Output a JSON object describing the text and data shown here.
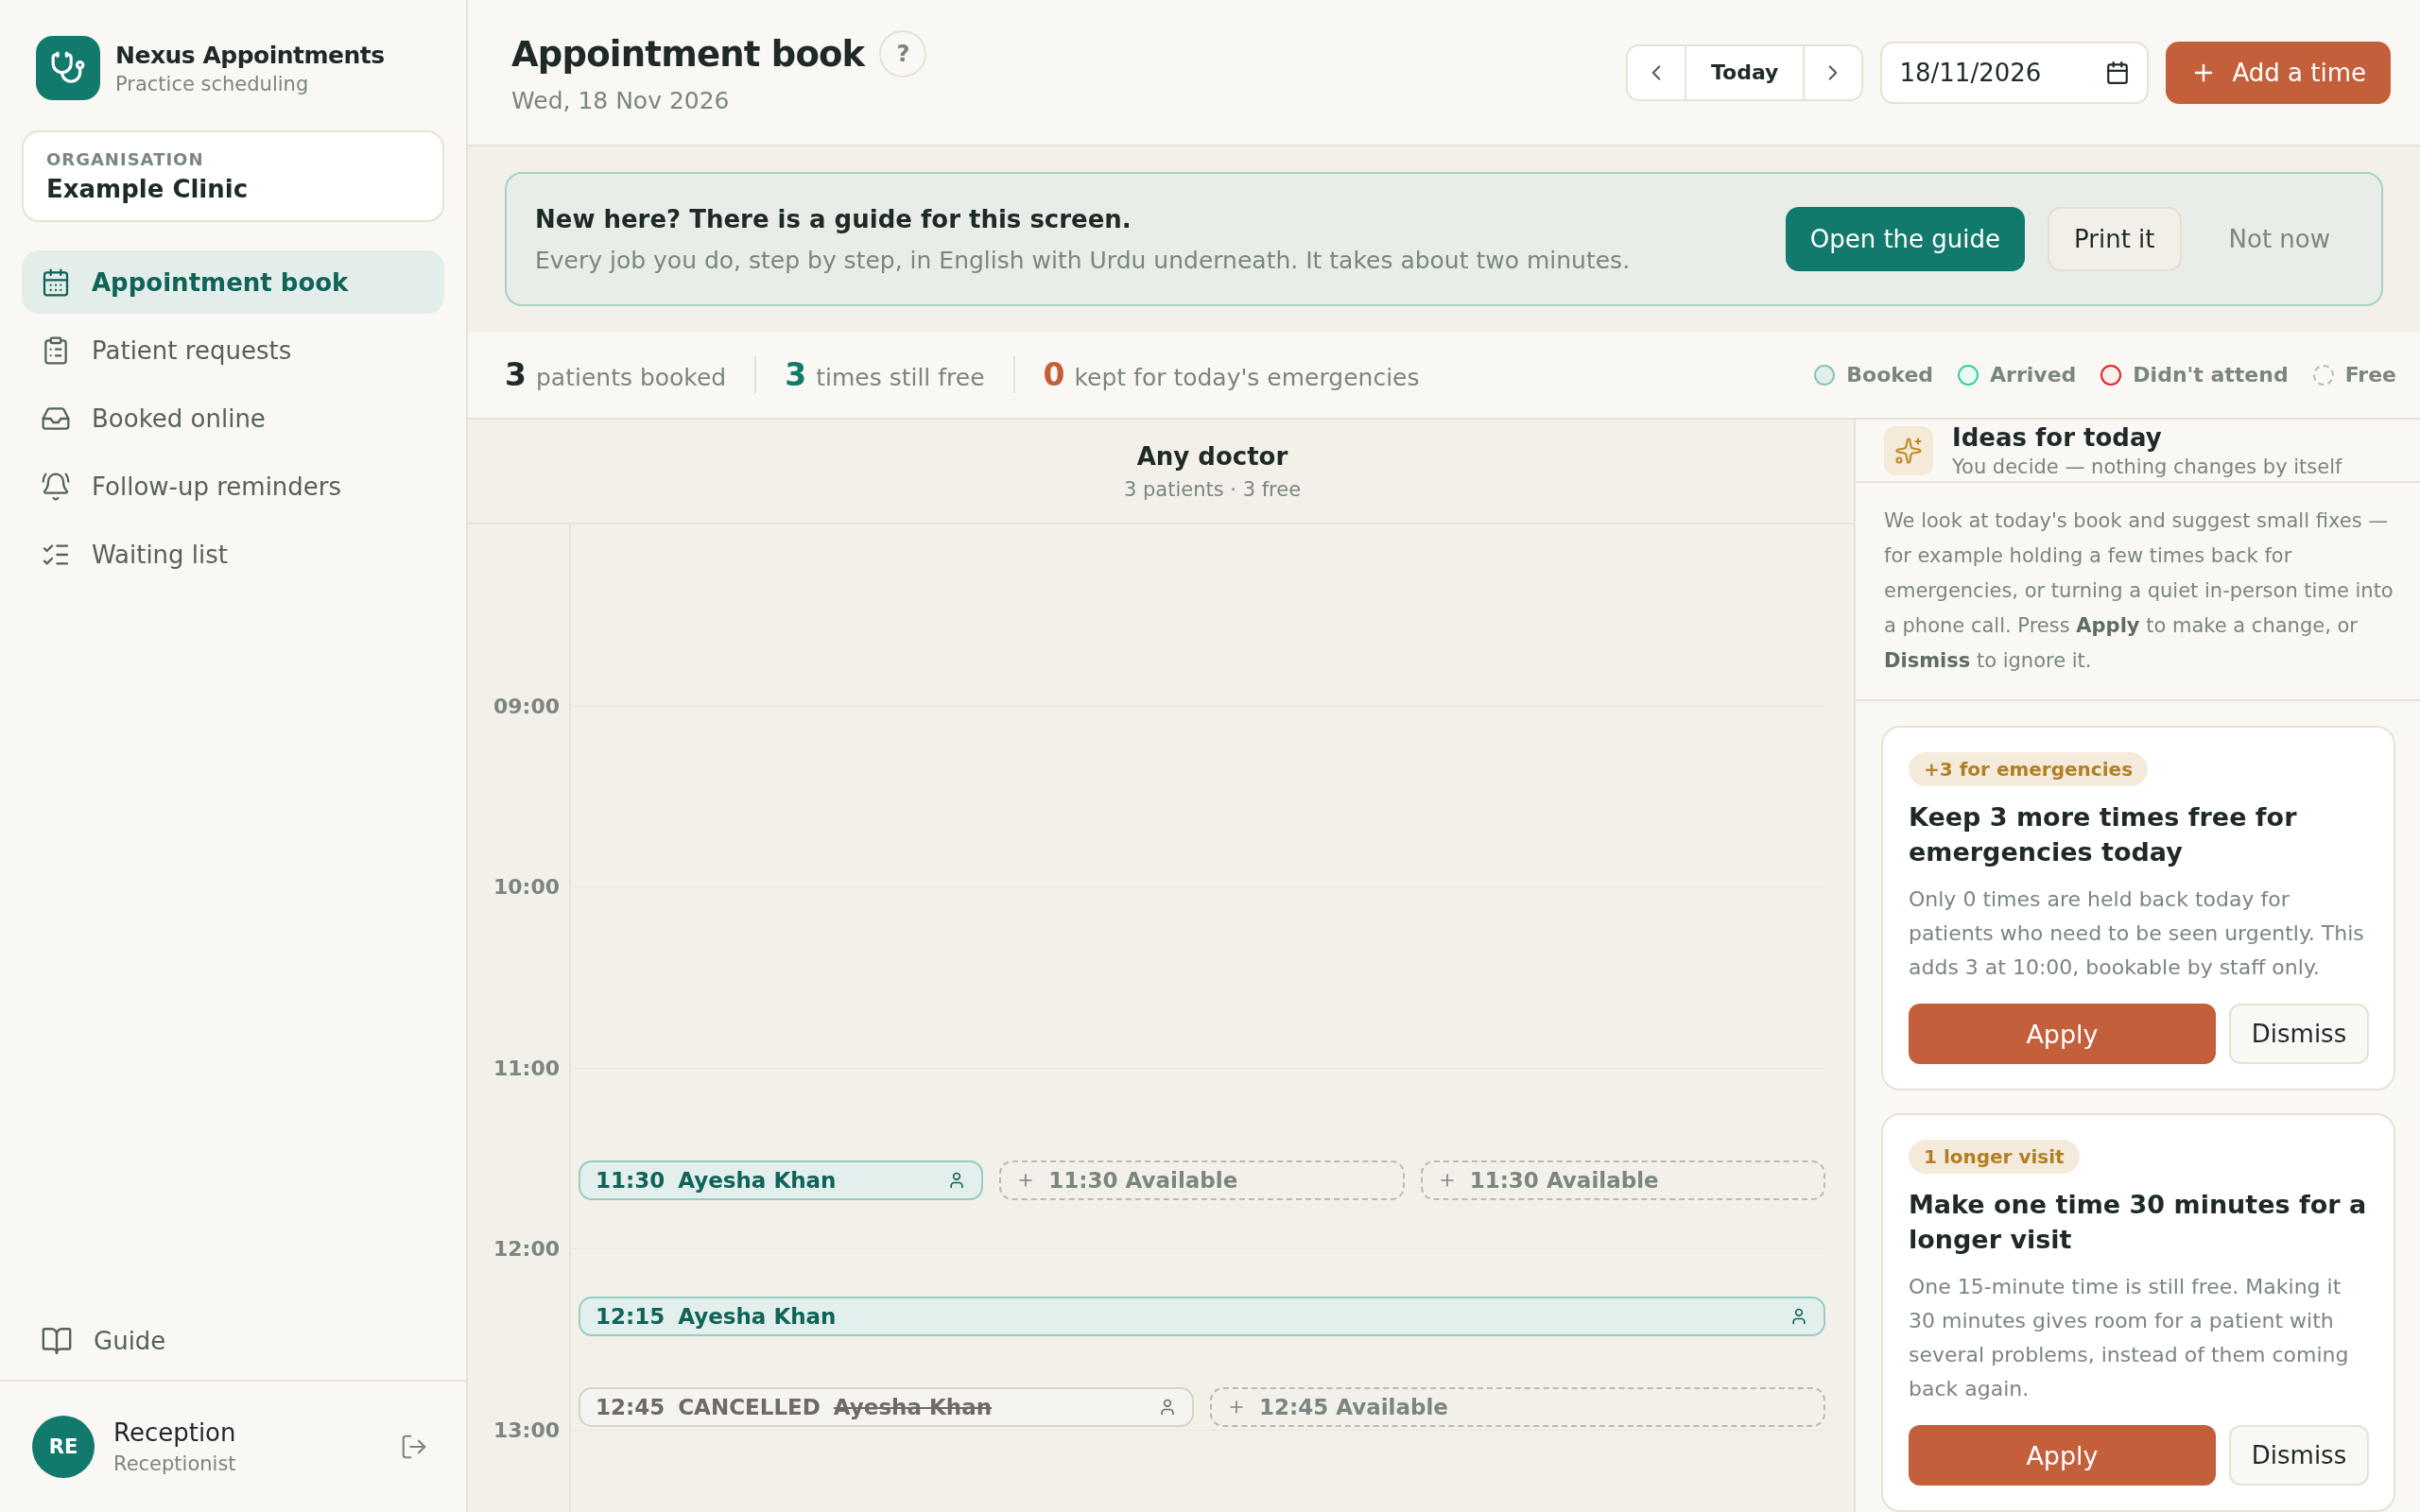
{
  "app": {
    "name": "Nexus Appointments",
    "subtitle": "Practice scheduling"
  },
  "organisation": {
    "label": "ORGANISATION",
    "name": "Example Clinic"
  },
  "nav": [
    {
      "label": "Appointment book",
      "selected": true
    },
    {
      "label": "Patient requests",
      "selected": false
    },
    {
      "label": "Booked online",
      "selected": false
    },
    {
      "label": "Follow-up reminders",
      "selected": false
    },
    {
      "label": "Waiting list",
      "selected": false
    }
  ],
  "guide_link": {
    "label": "Guide"
  },
  "user": {
    "initials": "RE",
    "name": "Reception",
    "role": "Receptionist"
  },
  "header": {
    "title": "Appointment book",
    "help": "?",
    "date": "Wed, 18 Nov 2026",
    "today": "Today",
    "date_field": "18/11/2026",
    "add": "Add a time"
  },
  "banner": {
    "title": "New here? There is a guide for this screen.",
    "text": "Every job you do, step by step, in English with Urdu underneath. It takes about two minutes.",
    "buttons": [
      {
        "label": "Open the guide",
        "kind": "primary"
      },
      {
        "label": "Print it",
        "kind": "secondary"
      },
      {
        "label": "Not now",
        "kind": "ghost"
      }
    ]
  },
  "stats": [
    {
      "value": "3",
      "label": "patients booked",
      "color": "#1f2a27"
    },
    {
      "value": "3",
      "label": "times still free",
      "color": "#127a6c"
    },
    {
      "value": "0",
      "label": "kept for today's emergencies",
      "color": "#c45f3c"
    }
  ],
  "legend": [
    {
      "label": "Booked",
      "kind": "booked"
    },
    {
      "label": "Arrived",
      "kind": "arrived"
    },
    {
      "label": "Didn't attend",
      "kind": "missed"
    },
    {
      "label": "Free",
      "kind": "free"
    }
  ],
  "calendar": {
    "column_title": "Any doctor",
    "column_subtitle": "3 patients · 3 free",
    "hours": [
      "09:00",
      "10:00",
      "11:00",
      "12:00",
      "13:00"
    ],
    "rows": [
      {
        "slots": [
          {
            "kind": "booked",
            "time": "11:30",
            "name": "Ayesha Khan"
          },
          {
            "kind": "free",
            "time": "11:30",
            "label": "Available"
          },
          {
            "kind": "free",
            "time": "11:30",
            "label": "Available"
          }
        ]
      },
      {
        "slots": [
          {
            "kind": "booked",
            "time": "12:15",
            "name": "Ayesha Khan"
          }
        ]
      },
      {
        "slots": [
          {
            "kind": "cancelled",
            "time": "12:45",
            "status": "CANCELLED",
            "name": "Ayesha Khan"
          },
          {
            "kind": "free",
            "time": "12:45",
            "label": "Available"
          }
        ]
      }
    ]
  },
  "ideas": {
    "title": "Ideas for today",
    "subtitle": "You decide — nothing changes by itself",
    "intro": "We look at today's book and suggest small fixes — for example holding a few times back for emergencies, or turning a quiet in-person time into a phone call. Press **Apply** to make a change, or **Dismiss** to ignore it.",
    "cards": [
      {
        "tag": "+3 for emergencies",
        "title": "Keep 3 more times free for emergencies today",
        "text": "Only 0 times are held back today for patients who need to be seen urgently. This adds 3 at 10:00, bookable by staff only.",
        "apply": "Apply",
        "dismiss": "Dismiss"
      },
      {
        "tag": "1 longer visit",
        "title": "Make one time 30 minutes for a longer visit",
        "text": "One 15-minute time is still free. Making it 30 minutes gives room for a patient with several problems, instead of them coming back again.",
        "apply": "Apply",
        "dismiss": "Dismiss"
      }
    ]
  }
}
